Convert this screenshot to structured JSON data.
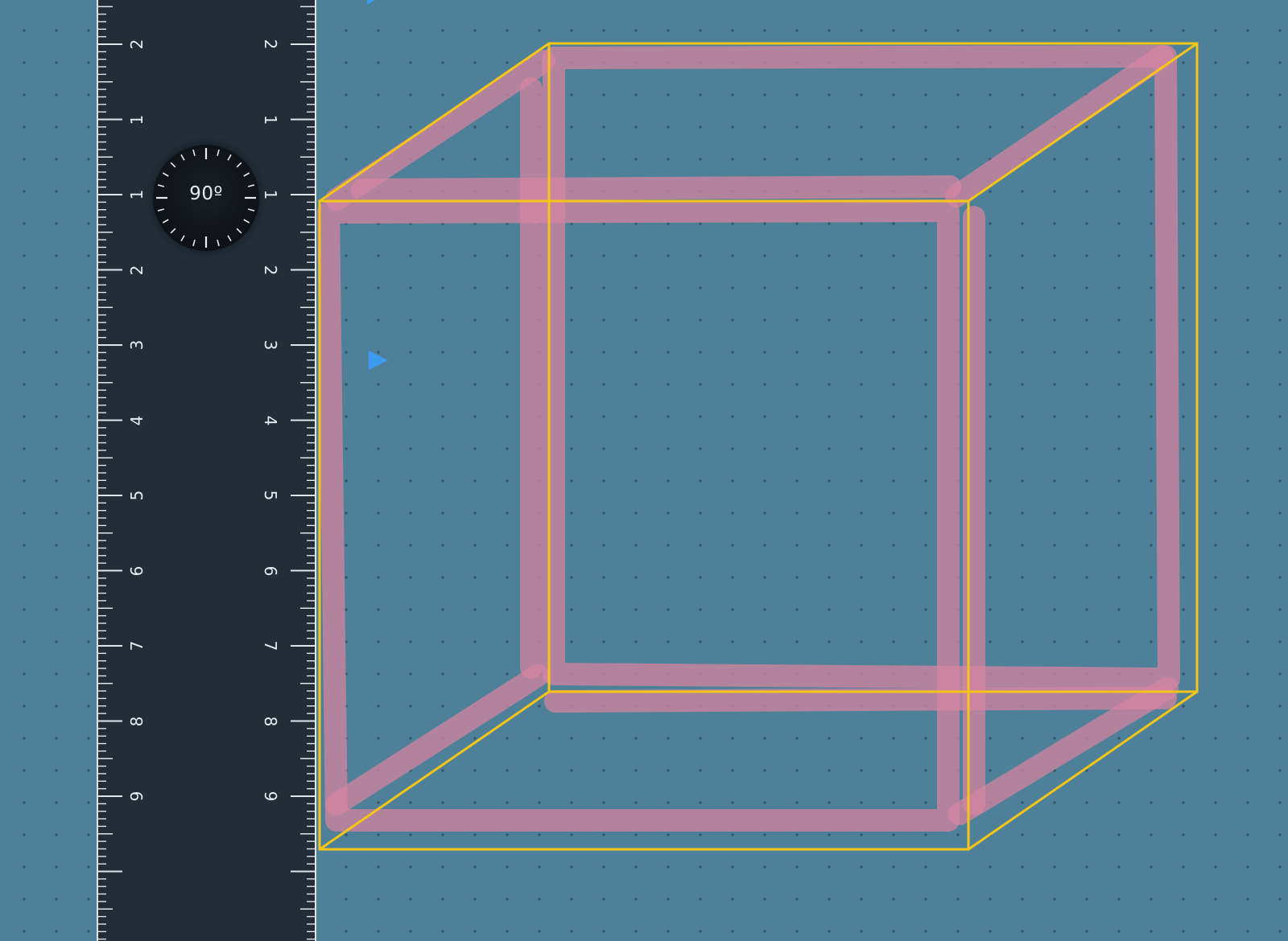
{
  "canvas": {
    "background_color": "#4e8199",
    "dot_grid_color": "#2e4f62"
  },
  "ruler": {
    "background_color": "#222d36",
    "tick_color": "#dfe6ea",
    "labels": [
      "2",
      "1",
      "1",
      "2",
      "3",
      "4",
      "5",
      "6",
      "7",
      "8",
      "9"
    ]
  },
  "protractor": {
    "angle_label": "90º"
  },
  "cursor": {
    "color": "#3a9bf0"
  },
  "cube": {
    "guide_color": "#f5c518",
    "stroke_color": "#d684a0",
    "stroke_opacity": 0.75
  }
}
